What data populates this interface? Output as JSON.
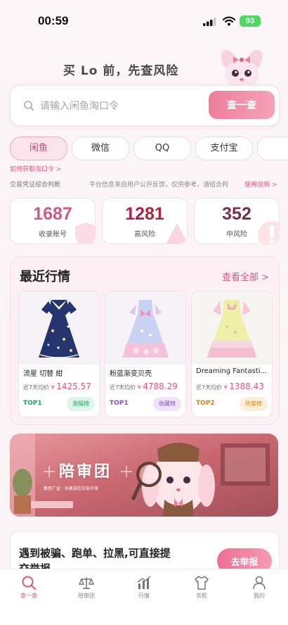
{
  "status_bar": {
    "time": "00:59",
    "battery": "93"
  },
  "header": {
    "slogan": "买 Lo 前，先查风险"
  },
  "search": {
    "placeholder": "请输入闲鱼淘口令",
    "button_label": "查一查"
  },
  "platform_tabs": [
    {
      "label": "闲鱼",
      "active": true
    },
    {
      "label": "微信"
    },
    {
      "label": "QQ"
    },
    {
      "label": "支付宝"
    }
  ],
  "hints": {
    "how_to": "如何获取淘口令 >",
    "left_note": "交易凭证综合判断",
    "right_note": "平台信息来自用户公开反馈，仅供参考，请结合判",
    "help_link": "使用说明 >"
  },
  "stats": [
    {
      "value": "1687",
      "label": "收录账号",
      "color": "#d05a85"
    },
    {
      "value": "1281",
      "label": "高风险",
      "color": "#b02342"
    },
    {
      "value": "352",
      "label": "中风险",
      "color": "#7a2e4c"
    }
  ],
  "market": {
    "title": "最近行情",
    "view_all": "查看全部 >",
    "items": [
      {
        "name": "流星 切替 紺",
        "price_prefix": "近7天均价",
        "currency": "¥",
        "price": "1425.57",
        "rank": "TOP1",
        "rank_color": "#1aa46a",
        "badge": "涨幅榜",
        "badge_color": "#1aa46a",
        "badge_bg": "#dff5ea"
      },
      {
        "name": "粉蓝渐变贝壳",
        "price_prefix": "近7天均价",
        "currency": "¥",
        "price": "4788.29",
        "rank": "TOP1",
        "rank_color": "#8a4fc9",
        "badge": "收藏榜",
        "badge_color": "#8a4fc9",
        "badge_bg": "#efe4fb"
      },
      {
        "name": "Dreaming Fantasti...",
        "price_prefix": "近7天均价",
        "currency": "¥",
        "price": "1388.43",
        "rank": "TOP2",
        "rank_color": "#d88618",
        "badge": "热度榜",
        "badge_color": "#d88618",
        "badge_bg": "#fcefd9"
      }
    ]
  },
  "banner": {
    "title": "陪审团",
    "subtitle": "集思广益 · 共建诚信交易环境"
  },
  "report": {
    "text": "遇到被骗、跑单、拉黑,可直接提交举报",
    "button_label": "去举报"
  },
  "bottom_nav": [
    {
      "label": "查一查",
      "icon": "search-icon",
      "active": true
    },
    {
      "label": "陪审团",
      "icon": "scales-icon"
    },
    {
      "label": "行情",
      "icon": "chart-icon"
    },
    {
      "label": "衣柜",
      "icon": "shirt-icon"
    },
    {
      "label": "我的",
      "icon": "person-icon"
    }
  ]
}
